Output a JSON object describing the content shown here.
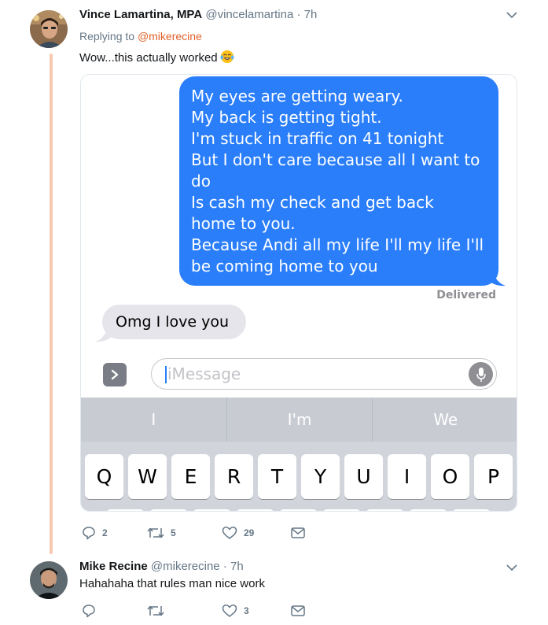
{
  "tweet1": {
    "name": "Vince Lamartina, MPA",
    "handle": "@vincelamartina",
    "dot": "·",
    "time": "7h",
    "replying_prefix": "Replying to",
    "replying_to": "@mikerecine",
    "text": "Wow...this actually worked",
    "emoji": "tears-of-joy-emoji",
    "media": {
      "blue_message_lines": [
        "My eyes are getting weary.",
        "My back is getting tight.",
        "I'm stuck in traffic on 41 tonight",
        "But I don't care because all I want to",
        "do",
        "Is cash my check and get back",
        "home to you.",
        "Because Andi all my life I'll my life I'll",
        "be coming home to you"
      ],
      "delivered": "Delivered",
      "gray_message": "Omg I love you",
      "input_placeholder": "iMessage",
      "suggestions": [
        "I",
        "I'm",
        "We"
      ],
      "keys": [
        "Q",
        "W",
        "E",
        "R",
        "T",
        "Y",
        "U",
        "I",
        "O",
        "P"
      ]
    },
    "actions": {
      "reply_count": "2",
      "retweet_count": "5",
      "like_count": "29"
    }
  },
  "tweet2": {
    "name": "Mike Recine",
    "handle": "@mikerecine",
    "dot": "·",
    "time": "7h",
    "text": "Hahahaha that rules man nice work",
    "actions": {
      "like_count": "3"
    }
  },
  "colors": {
    "imessage_blue": "#2a7efa",
    "mention_orange": "#e0622a",
    "thread_line": "#f7c9b0",
    "secondary_text": "#657786"
  }
}
